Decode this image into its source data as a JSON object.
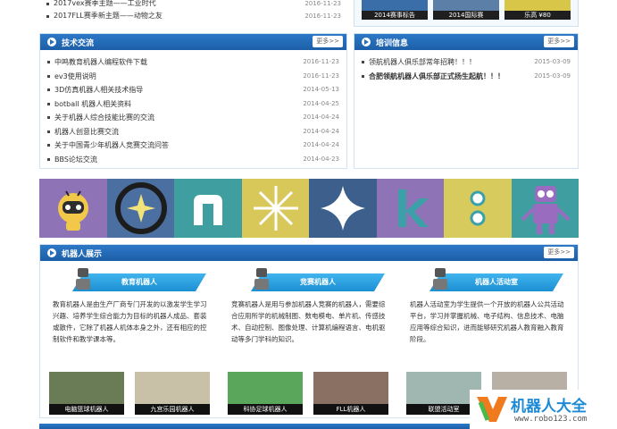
{
  "top_list": [
    {
      "title": "2017vex赛季主题——工业时代",
      "date": "2016-11-23"
    },
    {
      "title": "2017FLL赛季新主题——动物之友",
      "date": "2016-11-23"
    }
  ],
  "top_thumbs": [
    {
      "caption": "2014赛事标告"
    },
    {
      "caption": "2014国际赛"
    },
    {
      "caption": "乐高 ¥80"
    }
  ],
  "tech": {
    "title": "技术交流",
    "more": "更多>>",
    "items": [
      {
        "title": "中鸣教育机器人编程软件下载",
        "date": "2016-11-23"
      },
      {
        "title": "ev3使用说明",
        "date": "2016-11-23"
      },
      {
        "title": "3D仿真机器人相关技术指导",
        "date": "2014-05-13"
      },
      {
        "title": "botball 机器人相关资料",
        "date": "2014-04-25"
      },
      {
        "title": "关于机器人综合技能比赛的交流",
        "date": "2014-04-24"
      },
      {
        "title": "机器人创意比赛交流",
        "date": "2014-04-24"
      },
      {
        "title": "关于中国青少年机器人竞赛交流问答",
        "date": "2014-04-24"
      },
      {
        "title": "BBS论坛交流",
        "date": "2014-04-23"
      }
    ]
  },
  "training": {
    "title": "培训信息",
    "more": "更多>>",
    "items": [
      {
        "title": "领航机器人俱乐部常年招聘！！！",
        "date": "2015-03-09"
      },
      {
        "title": "合肥领航机器人俱乐部正式扬生起航！！！",
        "date": "2015-03-09"
      }
    ]
  },
  "showcase": {
    "title": "机器人展示",
    "more": "更多>>",
    "cards": [
      {
        "tab": "教育机器人",
        "desc": "教育机器人是由生产厂商专门开发的以激发学生学习兴趣、培养学生综合能力为目标的机器人成品、套装或散件，它除了机器人机体本身之外，还有相应的控制软件和教学课本等。",
        "images": [
          "电脑篮球机器人",
          "九宫乐园机器人"
        ]
      },
      {
        "tab": "竞赛机器人",
        "desc": "竞赛机器人是用与参加机器人竞赛的机器人，需要综合应用所学的机械制图、数电模电、单片机、传感技术、自动控制、图像处理、计算机编程语言、电机驱动等多门学科的知识。",
        "images": [
          "科协足球机器人",
          "FLL机器人"
        ]
      },
      {
        "tab": "机器人活动室",
        "desc": "机器人活动室为学生提供一个开放的机器人公共活动平台，学习并掌握机械、电子结构、信息技术、电脑应用等综合知识，进而能够研究机器人教育融入教育阶段。",
        "images": [
          "联盟活动室",
          ""
        ]
      }
    ]
  },
  "logo": {
    "brand": "机器人大全",
    "url": "www.robo123.com"
  },
  "colors": {
    "accent": "#1d6fbf",
    "tab": "#2aa3e6"
  }
}
